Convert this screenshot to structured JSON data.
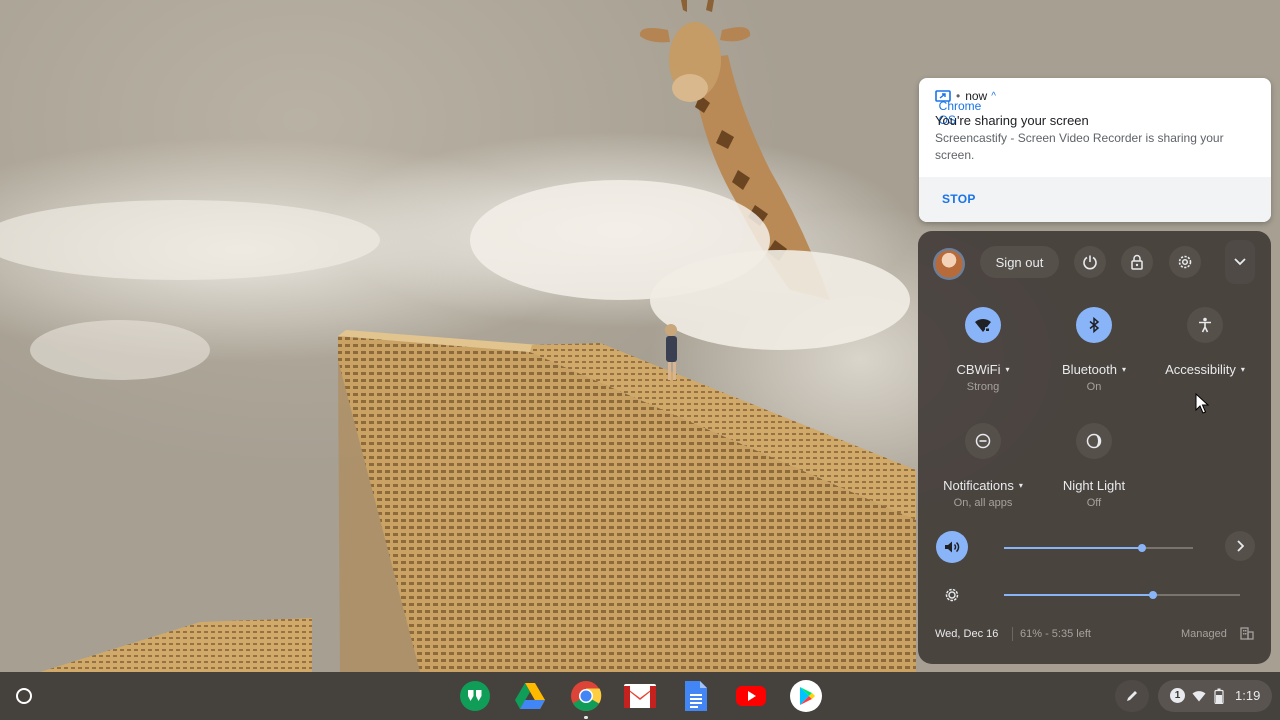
{
  "notification": {
    "app_name": "Chrome OS",
    "dot": "•",
    "time": "now",
    "caret": "^",
    "title": "You're sharing your screen",
    "body": "Screencastify - Screen Video Recorder is sharing your screen.",
    "action": "STOP"
  },
  "quick_settings": {
    "sign_out_label": "Sign out",
    "tiles": [
      {
        "label": "CBWiFi",
        "sub": "Strong",
        "icon": "wifi-icon",
        "on": true
      },
      {
        "label": "Bluetooth",
        "sub": "On",
        "icon": "bluetooth-icon",
        "on": true
      },
      {
        "label": "Accessibility",
        "sub": "",
        "icon": "accessibility-icon",
        "on": false
      },
      {
        "label": "Notifications",
        "sub": "On, all apps",
        "icon": "do-not-disturb-icon",
        "on": false
      },
      {
        "label": "Night Light",
        "sub": "Off",
        "icon": "night-light-icon",
        "on": false
      }
    ],
    "volume_level": 0.73,
    "brightness_level": 0.63,
    "date": "Wed, Dec 16",
    "battery": "61% - 5:35 left",
    "managed": "Managed",
    "tri": "▾"
  },
  "shelf": {
    "apps": [
      "hangouts-chat-icon",
      "google-drive-icon",
      "chrome-icon",
      "gmail-icon",
      "google-docs-icon",
      "youtube-icon",
      "play-store-icon"
    ],
    "notification_count": "1",
    "time": "1:19"
  },
  "colors": {
    "accent": "#8ab4f8",
    "notif_link": "#1a73e8",
    "panel": "#423c38"
  }
}
